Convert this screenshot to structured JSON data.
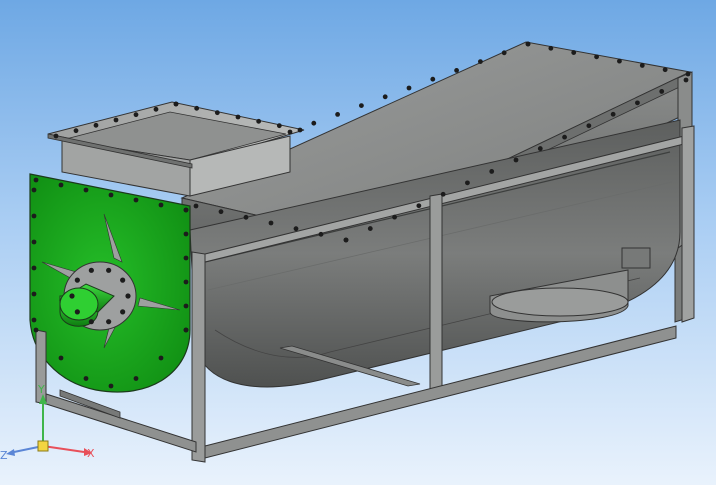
{
  "viewport": {
    "background_top": "#6ea8e4",
    "background_bottom": "#e9f2fc"
  },
  "model": {
    "body_color": "#7f8180",
    "end_cap_color": "#19a51c",
    "frame_color": "#8c8e8d",
    "bolt_color": "#1c1c1c"
  },
  "triad": {
    "x_label": "X",
    "y_label": "Y",
    "z_label": "Z",
    "x_color": "#e8505a",
    "y_color": "#3fb54a",
    "z_color": "#5b86d6"
  }
}
